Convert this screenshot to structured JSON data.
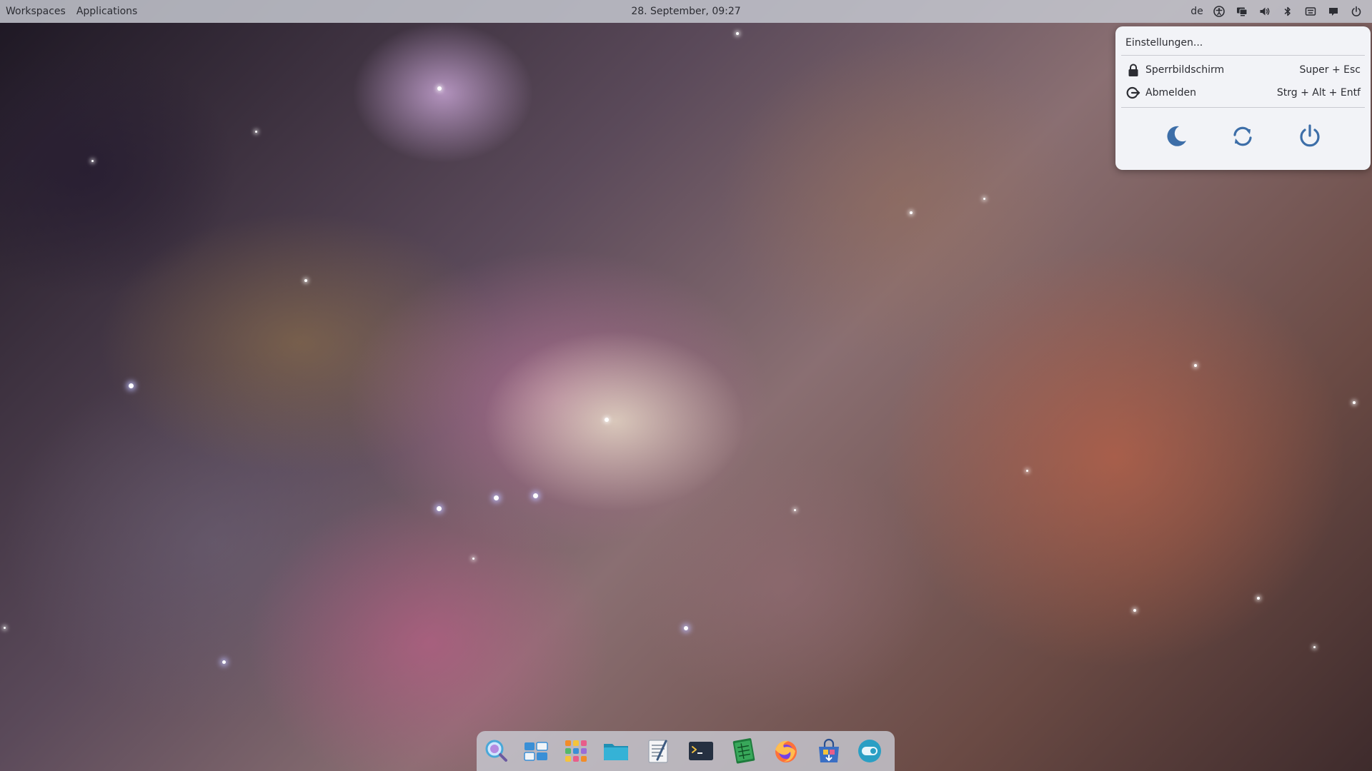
{
  "top_panel": {
    "workspaces_label": "Workspaces",
    "applications_label": "Applications",
    "clock": "28. September, 09:27",
    "language": "de",
    "tray_icons": [
      "accessibility-icon",
      "display-icon",
      "volume-icon",
      "bluetooth-icon",
      "keyboard-icon",
      "notifications-icon",
      "power-icon"
    ]
  },
  "power_menu": {
    "settings_label": "Einstellungen...",
    "lock": {
      "label": "Sperrbildschirm",
      "shortcut": "Super + Esc",
      "icon": "lock-icon"
    },
    "logout": {
      "label": "Abmelden",
      "shortcut": "Strg + Alt + Entf",
      "icon": "logout-icon"
    },
    "actions": [
      "suspend-icon",
      "restart-icon",
      "shutdown-icon"
    ]
  },
  "dock": {
    "items": [
      "search-app-icon",
      "window-switcher-icon",
      "app-launcher-icon",
      "files-icon",
      "text-editor-icon",
      "terminal-icon",
      "spreadsheet-icon",
      "firefox-icon",
      "software-center-icon",
      "toggle-app-icon"
    ]
  },
  "colors": {
    "panel_bg": "#c4c6ce",
    "menu_bg": "#f2f3f7",
    "text": "#2c2d33",
    "accent": "#3d6ea8"
  }
}
